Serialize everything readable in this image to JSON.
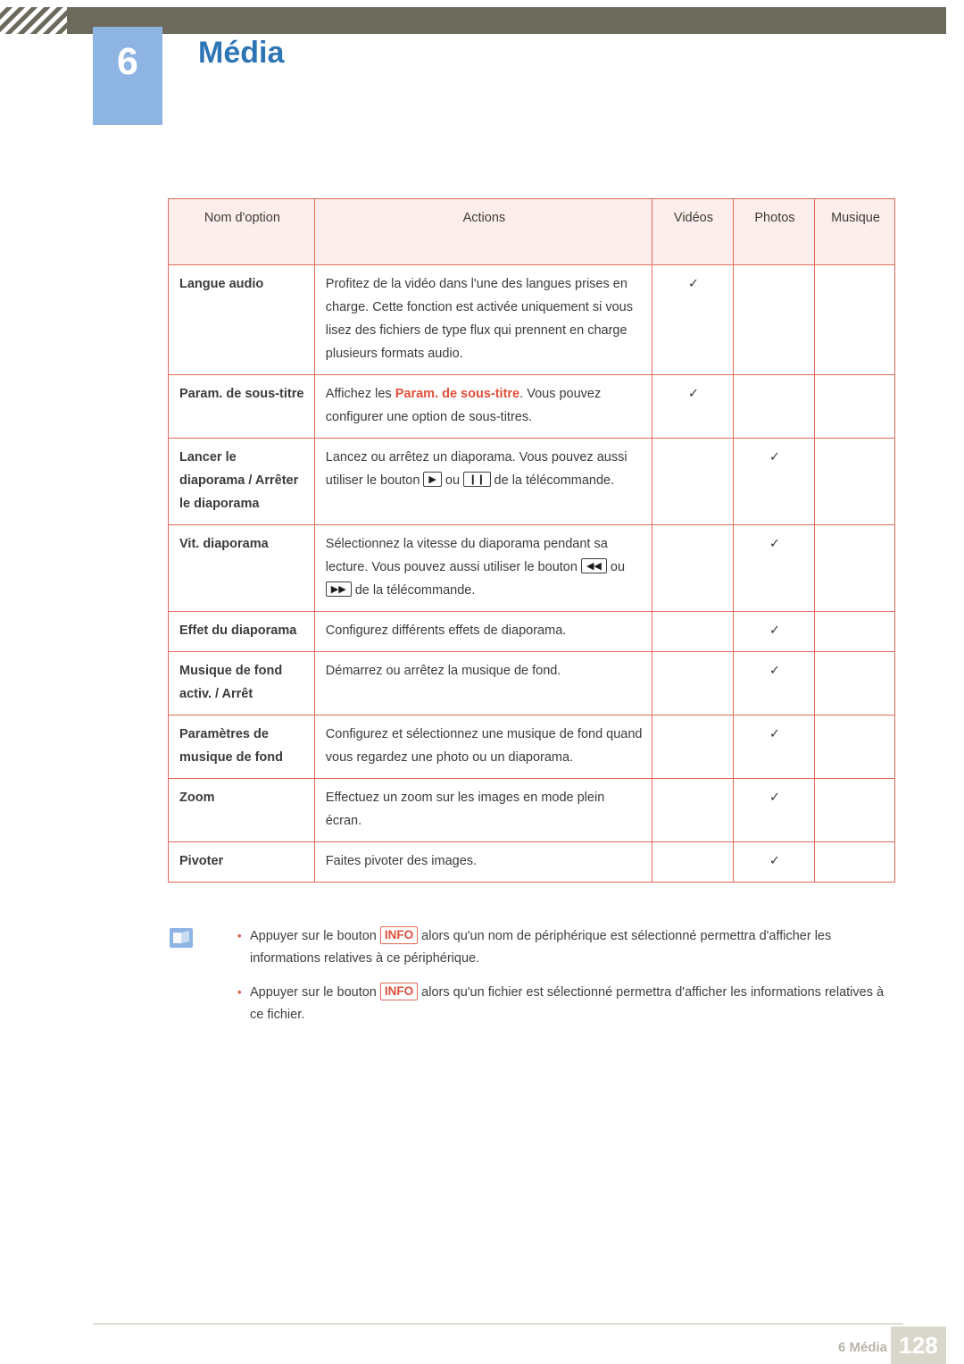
{
  "header": {
    "chapter_number": "6",
    "chapter_title": "Média",
    "bar_color": "#6c6a5c",
    "badge_color": "#8db4e3",
    "title_color": "#2e75b6"
  },
  "table": {
    "accent_color": "#e0503c",
    "header_bg": "#fdeeeb",
    "columns": [
      "Nom d'option",
      "Actions",
      "Vidéos",
      "Photos",
      "Musique"
    ],
    "check_glyph": "✓",
    "rows": [
      {
        "name": "Langue audio",
        "action": "Profitez de la vidéo dans l'une des langues prises en charge. Cette fonction est activée uniquement si vous lisez des fichiers de type flux qui prennent en charge plusieurs formats audio.",
        "videos": true,
        "photos": false,
        "musique": false
      },
      {
        "name": "Param. de sous-titre",
        "action_pre": "Affichez les ",
        "action_hl": "Param. de sous-titre",
        "action_post": ". Vous pouvez configurer une option de sous-titres.",
        "videos": true,
        "photos": false,
        "musique": false
      },
      {
        "name": "Lancer le diaporama / Arrêter le diaporama",
        "action_pre": "Lancez ou arrêtez un diaporama. Vous pouvez aussi utiliser le bouton ",
        "btn1": "▶",
        "action_mid": " ou ",
        "btn2": "❙❙",
        "action_post": " de la télécommande.",
        "videos": false,
        "photos": true,
        "musique": false
      },
      {
        "name": "Vit. diaporama",
        "action_pre": "Sélectionnez la vitesse du diaporama pendant sa lecture. Vous pouvez aussi utiliser le bouton ",
        "btn1": "◀◀",
        "action_mid": " ou ",
        "btn2": "▶▶",
        "action_post": " de la télécommande.",
        "videos": false,
        "photos": true,
        "musique": false
      },
      {
        "name": "Effet du diaporama",
        "action": "Configurez différents effets de diaporama.",
        "videos": false,
        "photos": true,
        "musique": false
      },
      {
        "name": "Musique de fond activ. / Arrêt",
        "action": "Démarrez ou arrêtez la musique de fond.",
        "videos": false,
        "photos": true,
        "musique": false
      },
      {
        "name": "Paramètres de musique de fond",
        "action": "Configurez et sélectionnez une musique de fond quand vous regardez une photo ou un diaporama.",
        "videos": false,
        "photos": true,
        "musique": false
      },
      {
        "name": "Zoom",
        "action": "Effectuez un zoom sur les images en mode plein écran.",
        "videos": false,
        "photos": true,
        "musique": false
      },
      {
        "name": "Pivoter",
        "action": "Faites pivoter des images.",
        "videos": false,
        "photos": true,
        "musique": false
      }
    ]
  },
  "notes": [
    {
      "pre": "Appuyer sur le bouton ",
      "key": "INFO",
      "post": " alors qu'un nom de périphérique est sélectionné permettra d'afficher les informations relatives à ce périphérique."
    },
    {
      "pre": "Appuyer sur le bouton ",
      "key": "INFO",
      "post": " alors qu'un fichier est sélectionné permettra d'afficher les informations relatives à ce fichier."
    }
  ],
  "footer": {
    "label": "6 Média",
    "page": "128"
  }
}
